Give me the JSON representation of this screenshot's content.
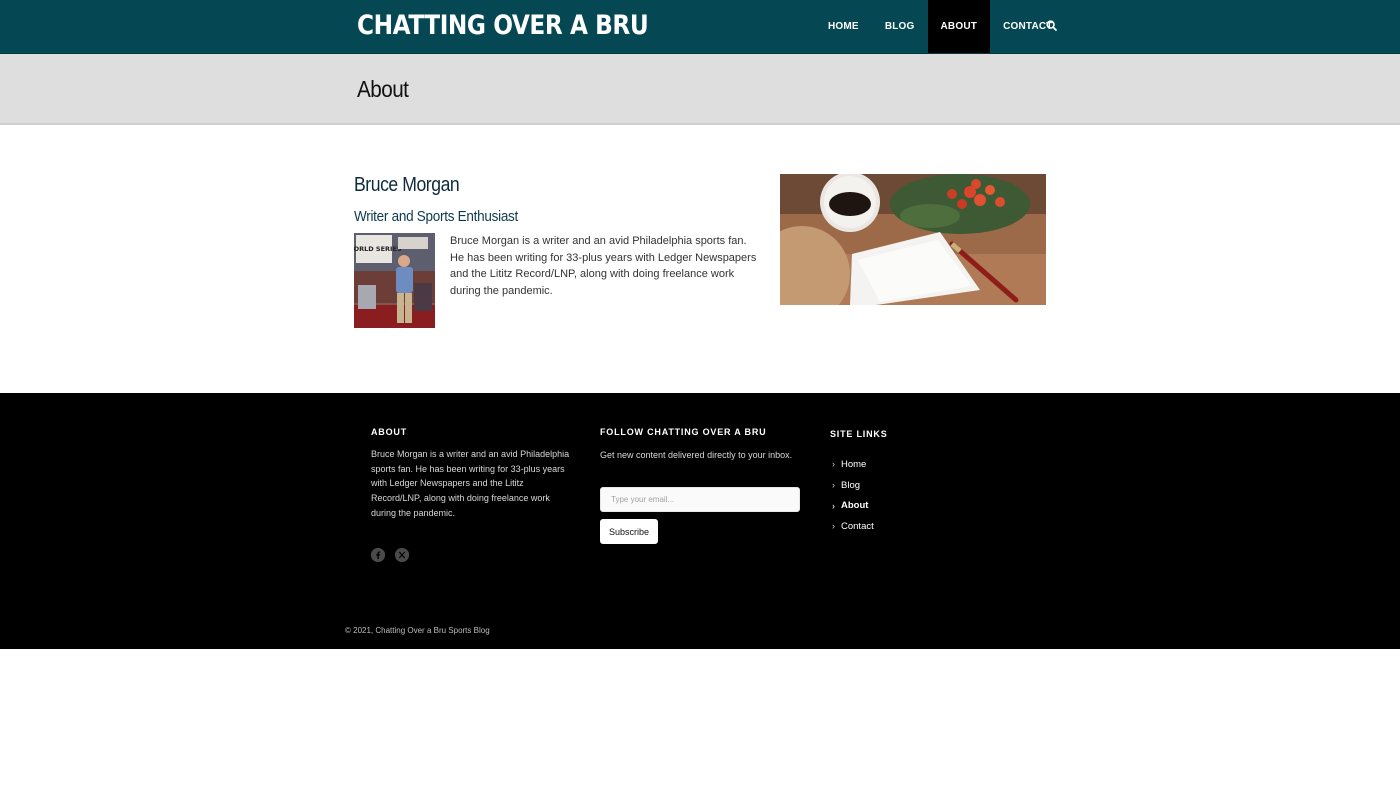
{
  "site": {
    "title": "CHATTING OVER A BRU",
    "brand_color": "#054752"
  },
  "nav": {
    "items": [
      {
        "label": "HOME",
        "active": false
      },
      {
        "label": "BLOG",
        "active": false
      },
      {
        "label": "ABOUT",
        "active": true
      },
      {
        "label": "CONTACT",
        "active": false
      }
    ],
    "search_icon": "search-icon"
  },
  "page": {
    "title": "About"
  },
  "author": {
    "name": "Bruce Morgan",
    "role": "Writer and Sports Enthusiast",
    "bio": "Bruce Morgan is a writer and an avid Philadelphia sports fan. He has been writing for 33-plus years with Ledger Newspapers and the Lititz Record/LNP, along with doing freelance work during the pandemic.",
    "photo_sign": "WORLD SERIES"
  },
  "footer": {
    "about": {
      "heading": "ABOUT",
      "text": "Bruce Morgan is a writer and an avid Philadelphia sports fan. He has been writing for 33-plus years with Ledger Newspapers and the Lititz Record/LNP, along with doing freelance work during the pandemic."
    },
    "social": [
      "facebook-icon",
      "x-twitter-icon"
    ],
    "follow": {
      "heading": "FOLLOW CHATTING OVER A BRU",
      "text": "Get new content delivered directly to your inbox.",
      "email_placeholder": "Type your email...",
      "email_value": "",
      "subscribe_label": "Subscribe"
    },
    "site_links": {
      "heading": "SITE LINKS",
      "items": [
        {
          "label": "Home",
          "current": false
        },
        {
          "label": "Blog",
          "current": false
        },
        {
          "label": "About",
          "current": true
        },
        {
          "label": "Contact",
          "current": false
        }
      ]
    },
    "copyright": "© 2021, Chatting Over a Bru Sports Blog"
  }
}
